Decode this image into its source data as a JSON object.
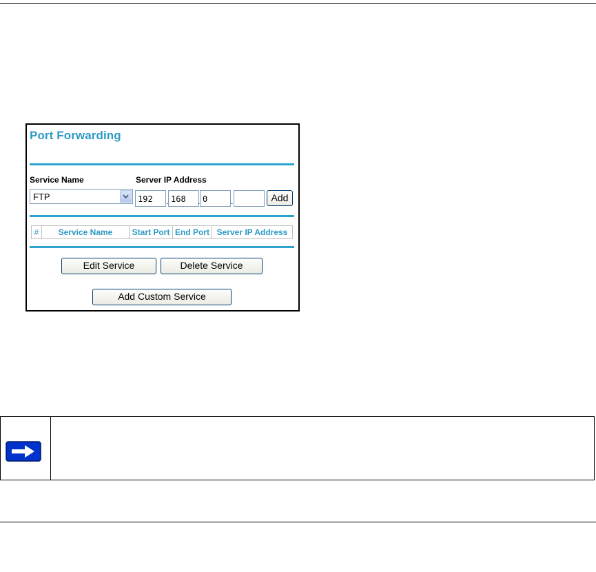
{
  "panel": {
    "title": "Port Forwarding",
    "service_name_label": "Service Name",
    "server_ip_label": "Server IP Address",
    "service_select": {
      "value": "FTP"
    },
    "ip_fields": [
      "192",
      "168",
      "0",
      ""
    ],
    "add_button": "Add",
    "table_headers": [
      "#",
      "Service Name",
      "Start Port",
      "End Port",
      "Server IP Address"
    ],
    "edit_button": "Edit Service",
    "delete_button": "Delete Service",
    "add_custom_button": "Add Custom Service"
  },
  "note": {
    "icon": "arrow-right-icon",
    "accent_color": "#0033cc"
  },
  "colors": {
    "title_blue": "#2c9ac4",
    "separator_blue": "#2ca3cf"
  }
}
